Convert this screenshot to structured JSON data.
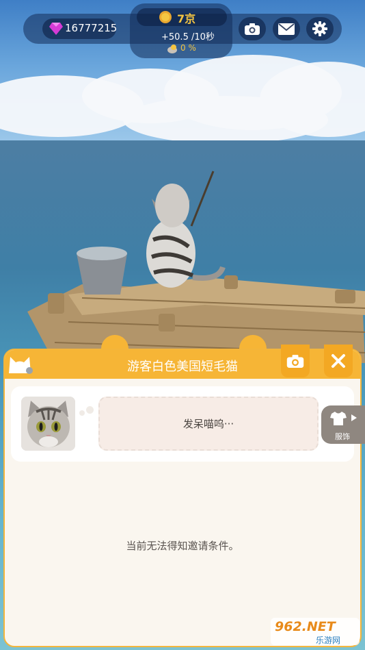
{
  "hud": {
    "gems": "16777215",
    "money": "7京",
    "rate": "+50.5 /10秒",
    "bonus": "0 %",
    "icons": [
      "gem-icon",
      "coin-icon",
      "camera-icon",
      "mail-icon",
      "gear-icon",
      "cat-bonus-icon"
    ]
  },
  "panel": {
    "title": "游客白色美国短毛猫",
    "speech": "发呆喵呜···",
    "outfit_label": "服饰",
    "invite_text": "当前无法得知邀请条件。"
  },
  "watermark": {
    "top": "962.NET",
    "bottom": "乐游网"
  },
  "colors": {
    "accent": "#f6b536",
    "gold": "#f4c542",
    "gem": "#d63bd6"
  }
}
